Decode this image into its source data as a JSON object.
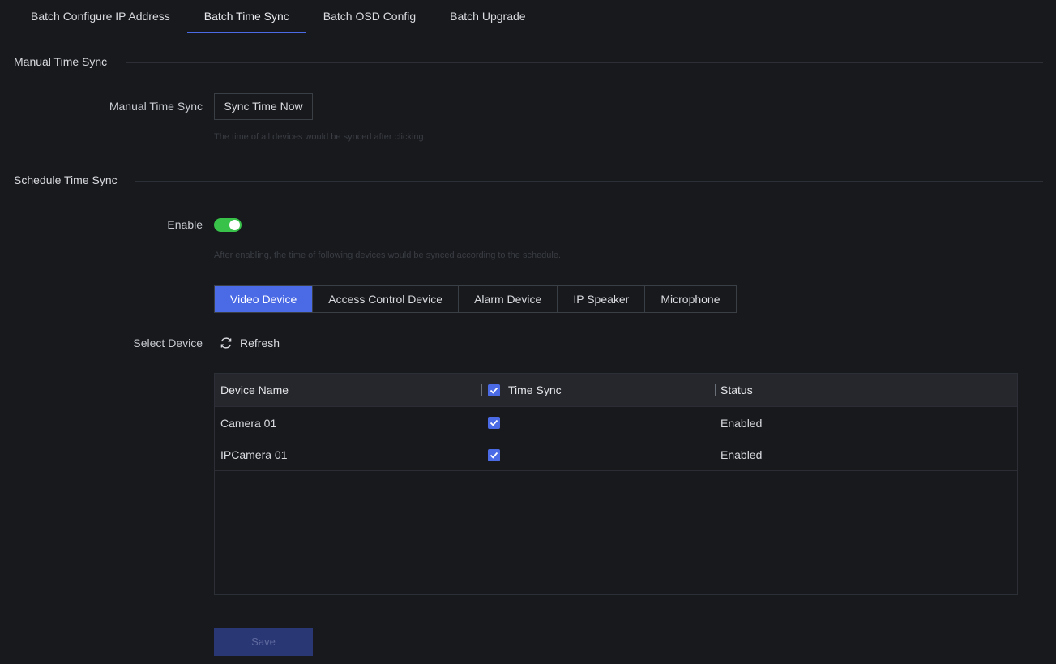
{
  "tabs": [
    {
      "label": "Batch Configure IP Address"
    },
    {
      "label": "Batch Time Sync",
      "active": true
    },
    {
      "label": "Batch OSD Config"
    },
    {
      "label": "Batch Upgrade"
    }
  ],
  "manual_section": {
    "title": "Manual Time Sync",
    "field_label": "Manual Time Sync",
    "button_label": "Sync Time Now",
    "hint": "The time of all devices would be synced after clicking."
  },
  "schedule_section": {
    "title": "Schedule Time Sync",
    "enable_label": "Enable",
    "enabled": true,
    "hint": "After enabling, the time of following devices would be synced according to the schedule.",
    "device_types": [
      {
        "label": "Video Device",
        "active": true
      },
      {
        "label": "Access Control Device"
      },
      {
        "label": "Alarm Device"
      },
      {
        "label": "IP Speaker"
      },
      {
        "label": "Microphone"
      }
    ],
    "select_device_label": "Select Device",
    "refresh_label": "Refresh",
    "table": {
      "columns": {
        "name": "Device Name",
        "sync": "Time Sync",
        "status": "Status"
      },
      "rows": [
        {
          "name": "Camera 01",
          "checked": true,
          "status": "Enabled"
        },
        {
          "name": "IPCamera 01",
          "checked": true,
          "status": "Enabled"
        }
      ]
    },
    "save_label": "Save"
  },
  "colors": {
    "accent": "#4a6ae6",
    "toggle_on": "#39c24a",
    "background": "#17191d"
  }
}
